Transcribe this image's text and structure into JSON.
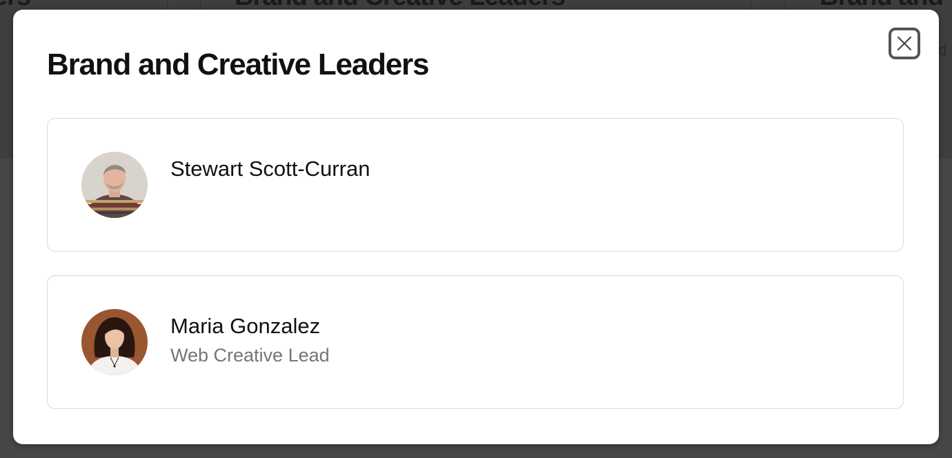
{
  "modal": {
    "title": "Brand and Creative Leaders",
    "close_icon": "close-icon"
  },
  "people": [
    {
      "name": "Stewart Scott-Curran",
      "role": "",
      "avatar": "avatar-photo-stewart"
    },
    {
      "name": "Maria Gonzalez",
      "role": "Web Creative Lead",
      "avatar": "avatar-photo-maria"
    }
  ],
  "background_page": {
    "headings": [
      "ers",
      "Brand and Creative Leaders",
      "Brand and"
    ],
    "subtext": "d"
  },
  "colors": {
    "overlay": "#474747",
    "modal_bg": "#ffffff",
    "card_border": "#d9d9d9",
    "title_text": "#111111",
    "role_text": "#757575",
    "close_border": "#555555"
  }
}
